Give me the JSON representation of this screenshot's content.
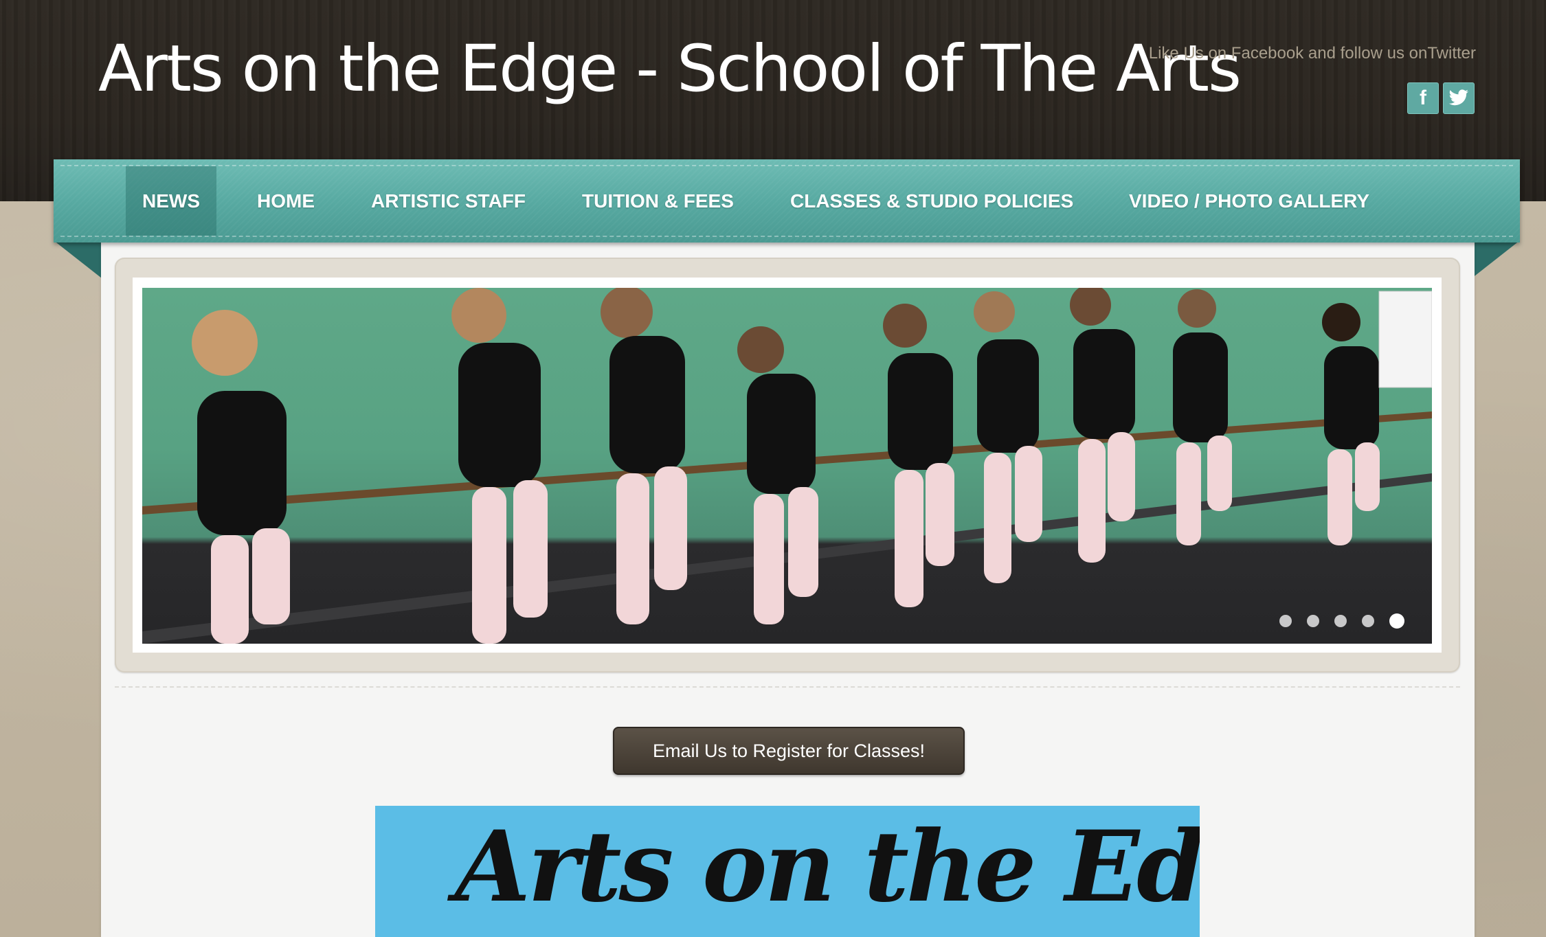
{
  "site": {
    "title": "Arts on the Edge - School of The Arts",
    "social_text": "Like Us on Facebook and follow us onTwitter",
    "social_icons": [
      {
        "name": "facebook-icon",
        "glyph": "f"
      },
      {
        "name": "twitter-icon",
        "glyph": "t"
      }
    ]
  },
  "nav": {
    "items": [
      {
        "label": "NEWS",
        "active": true
      },
      {
        "label": "HOME",
        "active": false
      },
      {
        "label": "ARTISTIC STAFF",
        "active": false
      },
      {
        "label": "TUITION & FEES",
        "active": false
      },
      {
        "label": "CLASSES & STUDIO POLICIES",
        "active": false
      },
      {
        "label": "VIDEO / PHOTO GALLERY",
        "active": false
      }
    ]
  },
  "slider": {
    "image_alt": "ballet dancers at barre",
    "slide_count": 5,
    "active_slide": 5
  },
  "cta": {
    "label": "Email Us to Register for Classes!"
  },
  "banner": {
    "text": "Arts on the Edge"
  },
  "colors": {
    "nav_teal": "#58aaa2",
    "header_dark": "#2a251f",
    "cta_brown": "#4a4238",
    "banner_blue": "#5bbde6"
  }
}
